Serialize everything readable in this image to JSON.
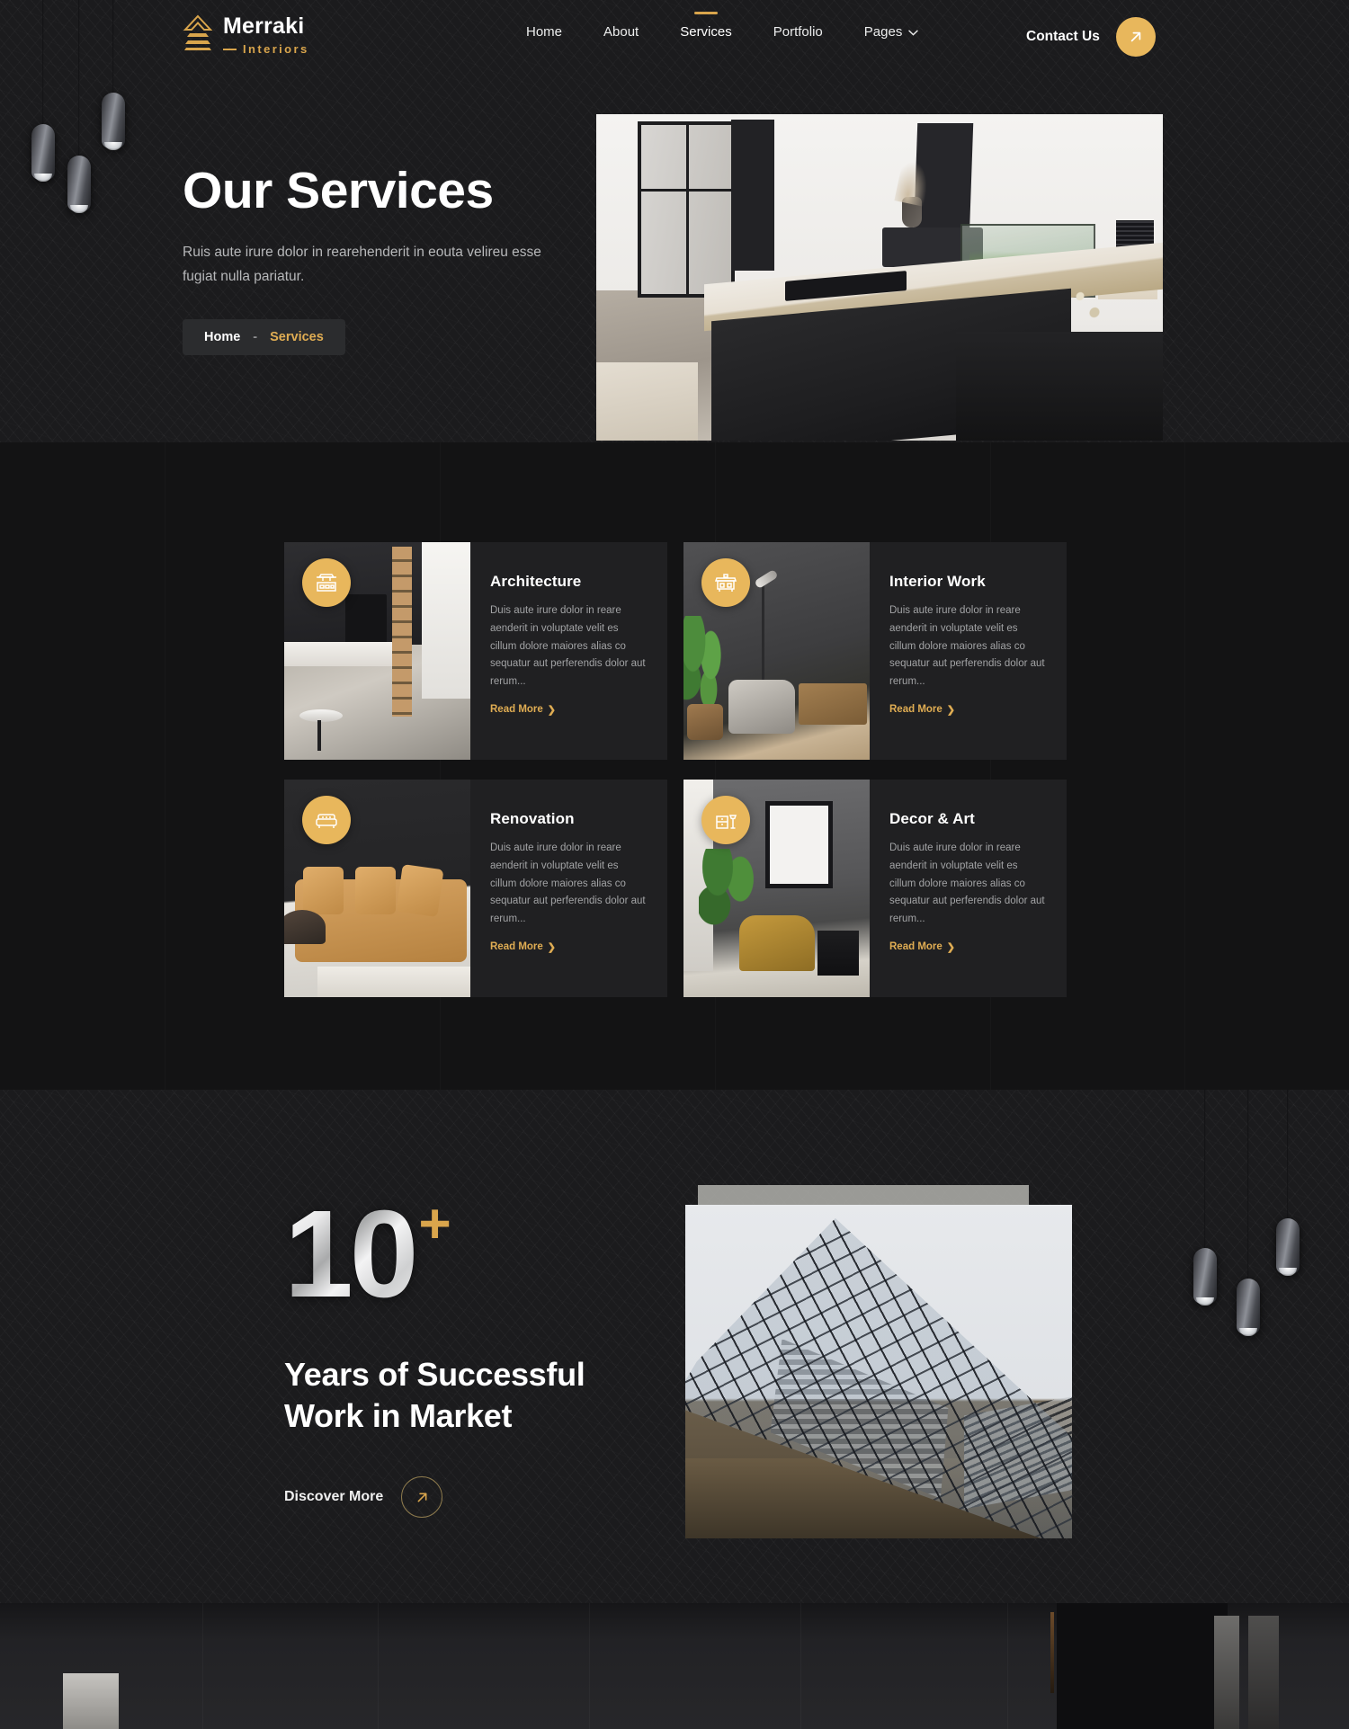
{
  "brand": {
    "name": "Merraki",
    "tagline": "Interiors",
    "logo_icon": "stacked-roof-logo-icon"
  },
  "nav": {
    "items": [
      {
        "label": "Home",
        "active": false
      },
      {
        "label": "About",
        "active": false
      },
      {
        "label": "Services",
        "active": true
      },
      {
        "label": "Portfolio",
        "active": false
      },
      {
        "label": "Pages",
        "active": false,
        "has_dropdown": true,
        "caret_icon": "chevron-down-icon"
      }
    ],
    "cta": {
      "label": "Contact Us",
      "icon": "arrow-up-right-icon",
      "color": "#e8b75c"
    }
  },
  "hero": {
    "title": "Our Services",
    "subtitle": "Ruis aute irure dolor in rearehenderit in eouta velireu esse fugiat nulla pariatur.",
    "breadcrumb": {
      "home": "Home",
      "separator": "-",
      "current": "Services"
    },
    "image_alt": "modern-dark-kitchen-island-photo"
  },
  "services": {
    "cards": [
      {
        "title": "Architecture",
        "description": "Duis aute irure dolor in reare aenderit in voluptate velit es cillum dolore maiores alias co sequatur aut perferendis dolor aut rerum...",
        "link": "Read More",
        "link_icon": "chevron-right-icon",
        "badge_icon": "architecture-table-icon",
        "image_alt": "kitchen-interior-photo"
      },
      {
        "title": "Interior Work",
        "description": "Duis aute irure dolor in reare aenderit in voluptate velit es cillum dolore maiores alias co sequatur aut perferendis dolor aut rerum...",
        "link": "Read More",
        "link_icon": "chevron-right-icon",
        "badge_icon": "sideboard-cabinet-icon",
        "image_alt": "lounge-chair-and-plant-photo"
      },
      {
        "title": "Renovation",
        "description": "Duis aute irure dolor in reare aenderit in voluptate velit es cillum dolore maiores alias co sequatur aut perferendis dolor aut rerum...",
        "link": "Read More",
        "link_icon": "chevron-right-icon",
        "badge_icon": "sofa-icon",
        "image_alt": "tan-leather-sofa-photo"
      },
      {
        "title": "Decor & Art",
        "description": "Duis aute irure dolor in reare aenderit in voluptate velit es cillum dolore maiores alias co sequatur aut perferendis dolor aut rerum...",
        "link": "Read More",
        "link_icon": "chevron-right-icon",
        "badge_icon": "dresser-lamp-icon",
        "image_alt": "armchair-with-framed-art-photo"
      }
    ]
  },
  "stats": {
    "number": "10",
    "plus": "+",
    "headline_line1": "Years of Successful",
    "headline_line2": "Work in Market",
    "cta": {
      "label": "Discover More",
      "icon": "arrow-up-right-icon"
    },
    "image_alt": "glass-skyscraper-looking-up-photo"
  },
  "decor": {
    "pendant_lamp_icon": "pendant-lamp-icon",
    "pendant_groups": 2
  },
  "colors": {
    "accent": "#e8b75c",
    "accent_text": "#e0ad53",
    "background": "#1b1b1d",
    "section_background": "#131314",
    "card_background": "#202022",
    "body_text": "#a2a3a5"
  }
}
